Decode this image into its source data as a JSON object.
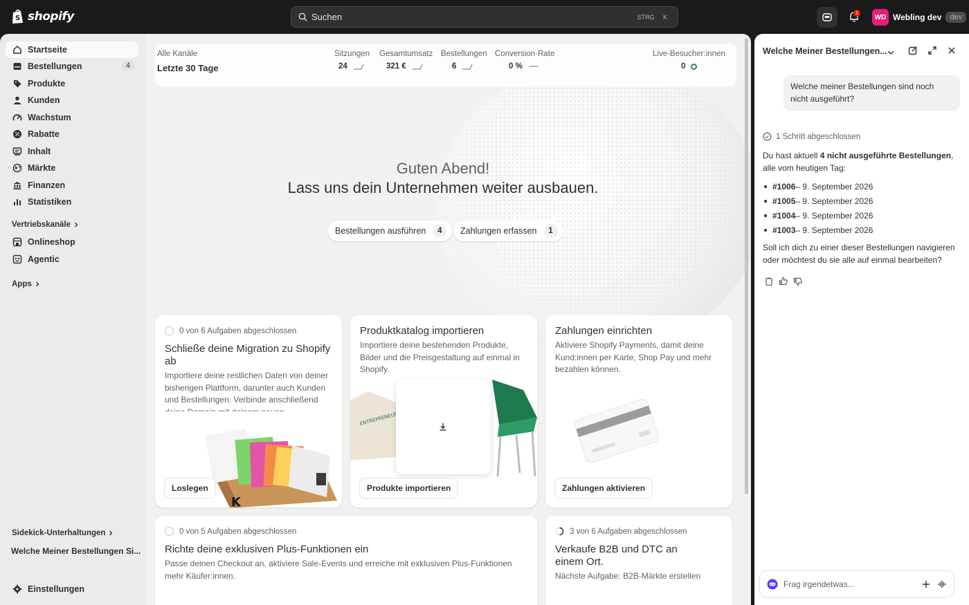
{
  "topbar": {
    "brand": "shopify",
    "search_placeholder": "Suchen",
    "shortcut_1": "STRG",
    "shortcut_2": "K",
    "notification_count": "1",
    "user_initials": "WD",
    "user_name": "Webling dev",
    "env_badge": "dev"
  },
  "sidebar": {
    "items": [
      {
        "label": "Startseite",
        "icon": "home-icon"
      },
      {
        "label": "Bestellungen",
        "icon": "orders-icon",
        "count": "4"
      },
      {
        "label": "Produkte",
        "icon": "tag-icon"
      },
      {
        "label": "Kunden",
        "icon": "person-icon"
      },
      {
        "label": "Wachstum",
        "icon": "gauge-icon"
      },
      {
        "label": "Rabatte",
        "icon": "discount-icon"
      },
      {
        "label": "Inhalt",
        "icon": "content-icon"
      },
      {
        "label": "Märkte",
        "icon": "globe-icon"
      },
      {
        "label": "Finanzen",
        "icon": "bank-icon"
      },
      {
        "label": "Statistiken",
        "icon": "bar-chart-icon"
      }
    ],
    "sales_channels_label": "Vertriebskanäle",
    "channels": [
      {
        "label": "Onlineshop",
        "icon": "store-icon"
      },
      {
        "label": "Agentic",
        "icon": "agentic-icon"
      }
    ],
    "apps_label": "Apps",
    "conversations_label": "Sidekick-Unterhaltungen",
    "conversation_item": "Welche Meiner Bestellungen Si...",
    "settings_label": "Einstellungen"
  },
  "stats": {
    "channel": "Alle Kanäle",
    "period": "Letzte 30 Tage",
    "metrics": [
      {
        "label": "Sitzungen",
        "value": "24"
      },
      {
        "label": "Gesamtumsatz",
        "value": "321 €"
      },
      {
        "label": "Bestellungen",
        "value": "6"
      },
      {
        "label": "Conversion-Rate",
        "value": "0 %"
      }
    ],
    "live_label": "Live-Besucher:innen",
    "live_value": "0"
  },
  "greeting": {
    "line1": "Guten Abend!",
    "line2": "Lass uns dein Unternehmen weiter ausbauen."
  },
  "pills": [
    {
      "label": "Bestellungen ausführen",
      "count": "4"
    },
    {
      "label": "Zahlungen erfassen",
      "count": "1"
    }
  ],
  "cards": {
    "migration": {
      "progress": "0 von 6 Aufgaben abgeschlossen",
      "title": "Schließe deine Migration zu Shopify ab",
      "desc": "Importiere deine restlichen Daten von deiner bisherigen Plattform, darunter auch Kunden und Bestellungen. Verbinde anschließend deine Domain mit deinem neuen",
      "button": "Loslegen"
    },
    "catalog": {
      "title": "Produktkatalog importieren",
      "desc": "Importiere deine bestehenden Produkte, Bilder und die Preisgestaltung auf einmal in Shopify.",
      "button": "Produkte importieren"
    },
    "payments": {
      "title": "Zahlungen einrichten",
      "desc": "Aktiviere Shopify Payments, damit deine Kund:innen per Karte, Shop Pay und mehr bezahlen können.",
      "button": "Zahlungen aktivieren"
    },
    "plus": {
      "progress": "0 von 5 Aufgaben abgeschlossen",
      "title": "Richte deine exklusiven Plus-Funktionen ein",
      "desc": "Passe deinen Checkout an, aktiviere Sale-Events und erreiche mit exklusiven Plus-Funktionen mehr Käufer:innen."
    },
    "b2b": {
      "progress": "3 von 6 Aufgaben abgeschlossen",
      "title": "Verkaufe B2B und DTC an einem Ort.",
      "desc": "Nächste Aufgabe: B2B-Märkte erstellen"
    }
  },
  "sidekick": {
    "title": "Welche Meiner Bestellungen...",
    "user_message": "Welche meiner Bestellungen sind noch nicht ausgeführt?",
    "step": "1 Schritt abgeschlossen",
    "answer_pre": "Du hast aktuell ",
    "answer_bold": "4 nicht ausgeführte Bestellungen",
    "answer_post": ", alle vom heutigen Tag:",
    "orders": [
      {
        "id": "#1006",
        "date": " – 9. September 2026"
      },
      {
        "id": "#1005",
        "date": " – 9. September 2026"
      },
      {
        "id": "#1004",
        "date": " – 9. September 2026"
      },
      {
        "id": "#1003",
        "date": " – 9. September 2026"
      }
    ],
    "followup": "Soll ich dich zu einer dieser Bestellungen navigieren oder möchtest du sie alle auf einmal bearbeiten?",
    "input_placeholder": "Frag irgendetwas..."
  }
}
